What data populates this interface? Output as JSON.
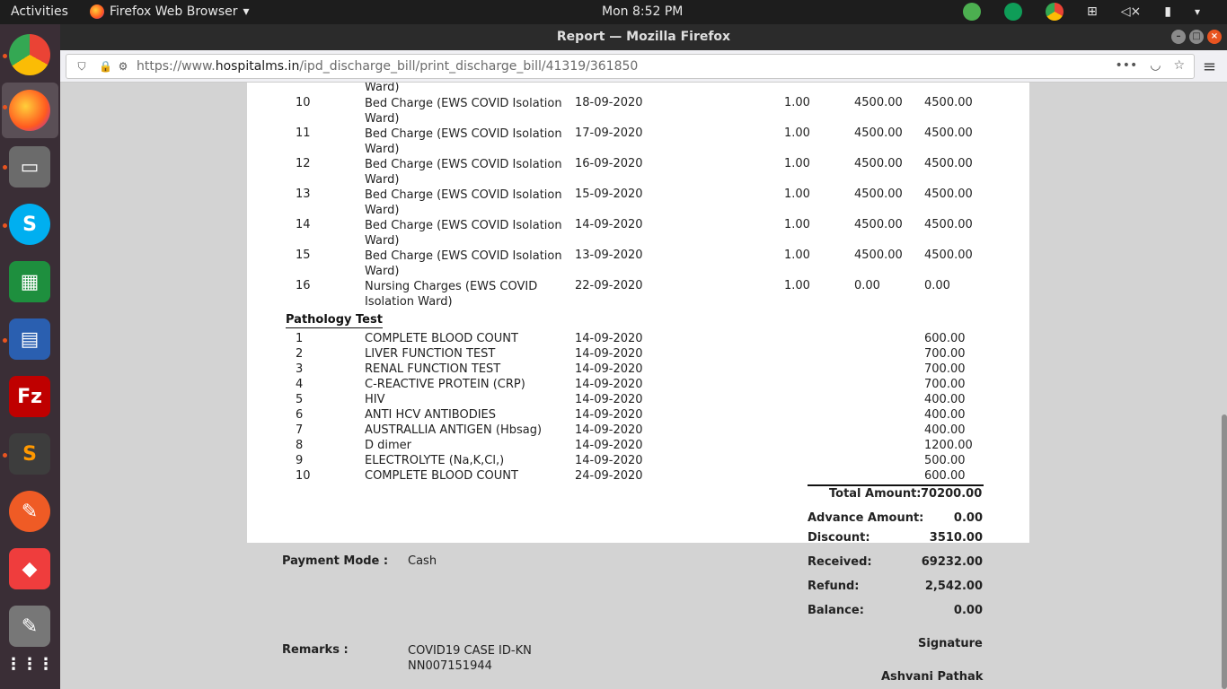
{
  "topbar": {
    "activities": "Activities",
    "app_name": "Firefox Web Browser",
    "clock": "Mon  8:52 PM"
  },
  "window": {
    "title": "Report — Mozilla Firefox",
    "url_prefix": "https://www.",
    "url_domain": "hospitalms.in",
    "url_path": "/ipd_discharge_bill/print_discharge_bill/41319/361850"
  },
  "bed_rows": [
    {
      "no": "10",
      "desc": "Bed Charge (EWS COVID Isolation Ward)",
      "date": "18-09-2020",
      "qty": "1.00",
      "rate": "4500.00",
      "amount": "4500.00"
    },
    {
      "no": "11",
      "desc": "Bed Charge (EWS COVID Isolation Ward)",
      "date": "17-09-2020",
      "qty": "1.00",
      "rate": "4500.00",
      "amount": "4500.00"
    },
    {
      "no": "12",
      "desc": "Bed Charge (EWS COVID Isolation Ward)",
      "date": "16-09-2020",
      "qty": "1.00",
      "rate": "4500.00",
      "amount": "4500.00"
    },
    {
      "no": "13",
      "desc": "Bed Charge (EWS COVID Isolation Ward)",
      "date": "15-09-2020",
      "qty": "1.00",
      "rate": "4500.00",
      "amount": "4500.00"
    },
    {
      "no": "14",
      "desc": "Bed Charge (EWS COVID Isolation Ward)",
      "date": "14-09-2020",
      "qty": "1.00",
      "rate": "4500.00",
      "amount": "4500.00"
    },
    {
      "no": "15",
      "desc": "Bed Charge (EWS COVID Isolation Ward)",
      "date": "13-09-2020",
      "qty": "1.00",
      "rate": "4500.00",
      "amount": "4500.00"
    },
    {
      "no": "16",
      "desc": "Nursing Charges (EWS COVID Isolation Ward)",
      "date": "22-09-2020",
      "qty": "1.00",
      "rate": "0.00",
      "amount": "0.00"
    }
  ],
  "bed_top_fragment": "Ward)",
  "pathology": {
    "title": "Pathology Test",
    "rows": [
      {
        "no": "1",
        "desc": "COMPLETE BLOOD COUNT",
        "date": "14-09-2020",
        "amount": "600.00"
      },
      {
        "no": "2",
        "desc": "LIVER FUNCTION TEST",
        "date": "14-09-2020",
        "amount": "700.00"
      },
      {
        "no": "3",
        "desc": "RENAL FUNCTION TEST",
        "date": "14-09-2020",
        "amount": "700.00"
      },
      {
        "no": "4",
        "desc": "C-REACTIVE PROTEIN (CRP)",
        "date": "14-09-2020",
        "amount": "700.00"
      },
      {
        "no": "5",
        "desc": "HIV",
        "date": "14-09-2020",
        "amount": "400.00"
      },
      {
        "no": "6",
        "desc": "ANTI HCV ANTIBODIES",
        "date": "14-09-2020",
        "amount": "400.00"
      },
      {
        "no": "7",
        "desc": "AUSTRALLIA ANTIGEN (Hbsag)",
        "date": "14-09-2020",
        "amount": "400.00"
      },
      {
        "no": "8",
        "desc": "D dimer",
        "date": "14-09-2020",
        "amount": "1200.00"
      },
      {
        "no": "9",
        "desc": "ELECTROLYTE (Na,K,Cl,)",
        "date": "14-09-2020",
        "amount": "500.00"
      },
      {
        "no": "10",
        "desc": "COMPLETE BLOOD COUNT",
        "date": "24-09-2020",
        "amount": "600.00"
      }
    ]
  },
  "totals": {
    "total_label": "Total Amount:",
    "total_value": "70200.00",
    "advance_label": "Advance Amount:",
    "advance_value": "0.00",
    "discount_label": "Discount:",
    "discount_value": "3510.00",
    "received_label": "Received:",
    "received_value": "69232.00",
    "refund_label": "Refund:",
    "refund_value": "2,542.00",
    "balance_label": "Balance:",
    "balance_value": "0.00"
  },
  "payment": {
    "mode_label": "Payment Mode :",
    "mode_value": "Cash",
    "remarks_label": "Remarks :",
    "remarks_value": "COVID19 CASE ID-KNNN007151944"
  },
  "signature": {
    "label": "Signature",
    "name": "Ashvani Pathak"
  }
}
